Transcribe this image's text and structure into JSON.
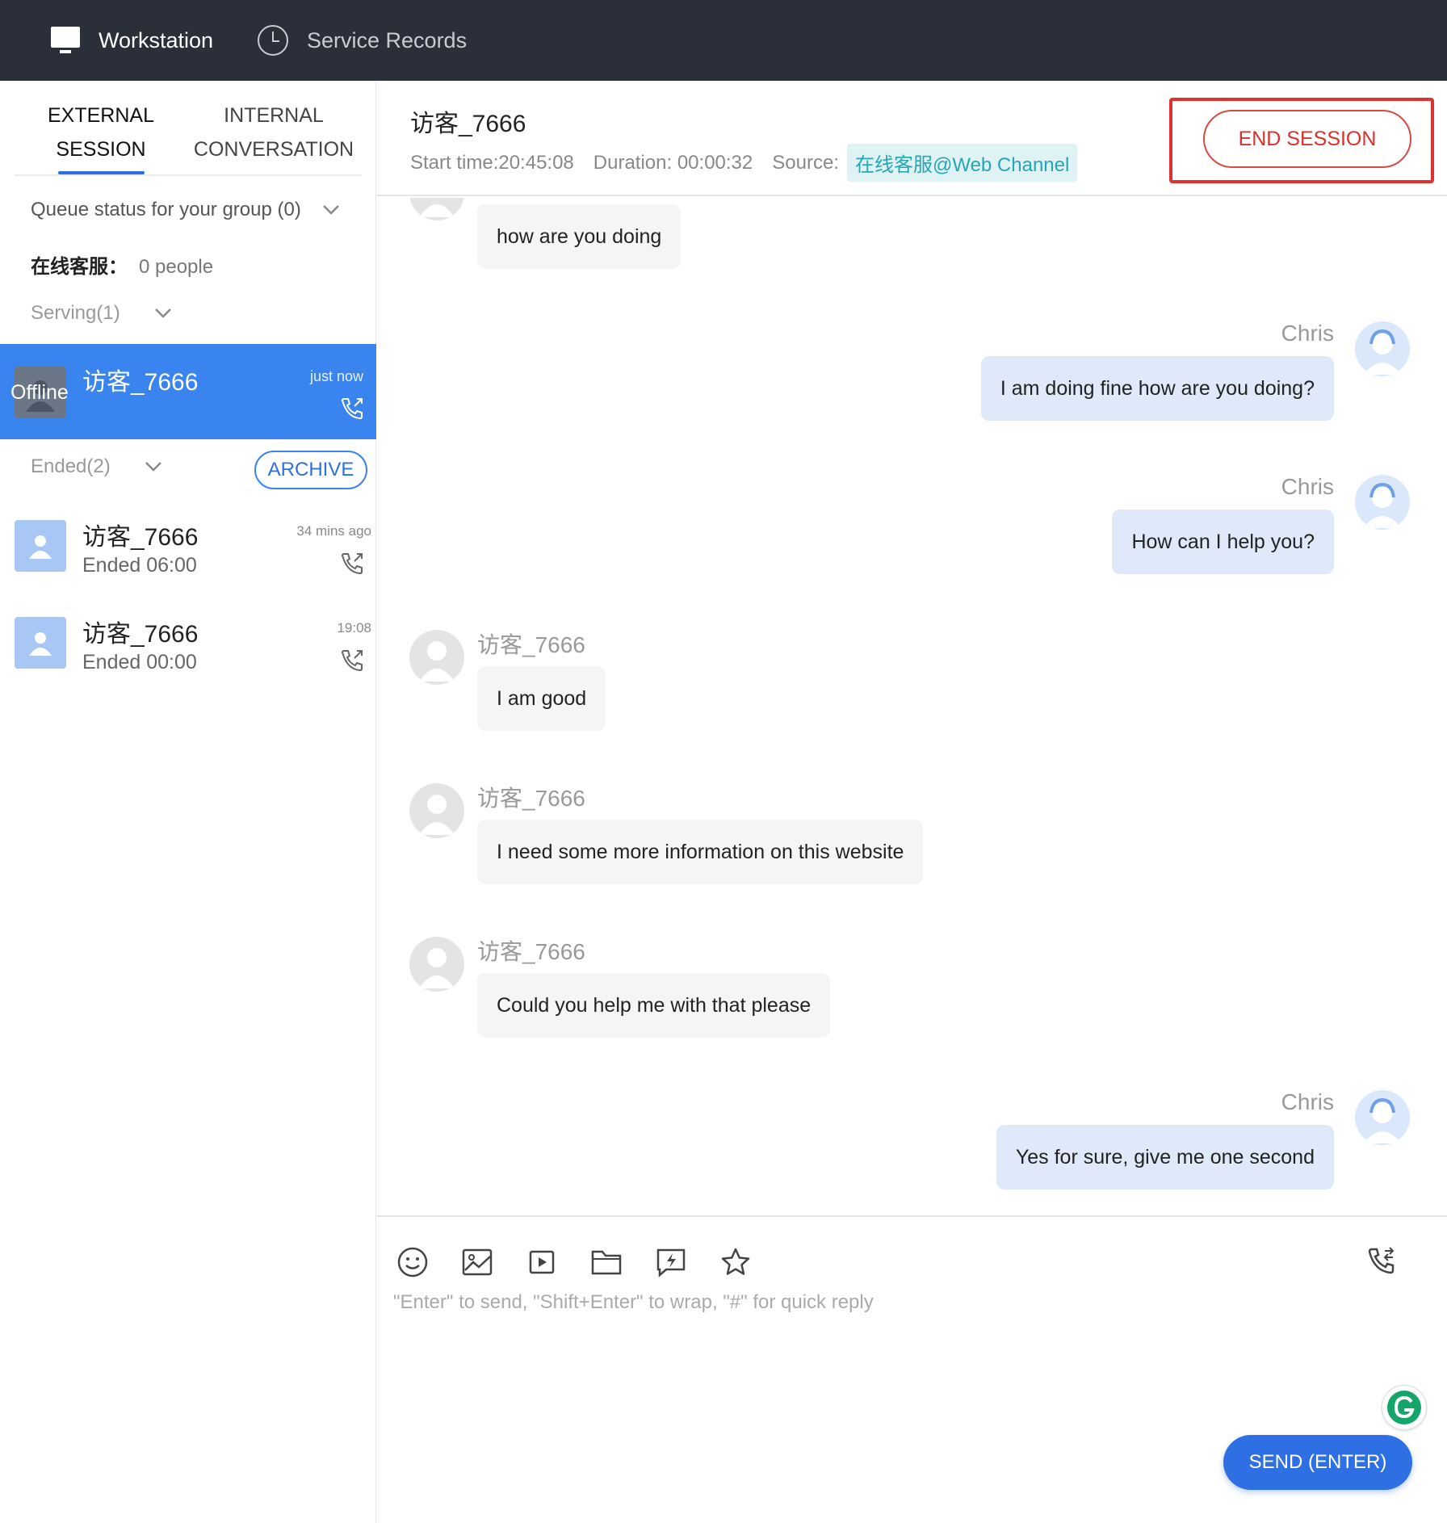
{
  "topbar": {
    "workstation_label": "Workstation",
    "service_records_label": "Service Records",
    "icons": {
      "workstation": "monitor-icon",
      "service_records": "clock-icon"
    }
  },
  "sidebar": {
    "tabs": [
      {
        "line1": "EXTERNAL",
        "line2": "SESSION",
        "active": true
      },
      {
        "line1": "INTERNAL",
        "line2": "CONVERSATION",
        "active": false
      }
    ],
    "queue_status": "Queue status for your group (0)",
    "online_group": "在线客服：",
    "online_count": "0 people",
    "serving_label": "Serving(1)",
    "active_session": {
      "name": "访客_7666",
      "time": "just now",
      "status": "Offline"
    },
    "ended_label": "Ended(2)",
    "archive_label": "ARCHIVE",
    "ended_sessions": [
      {
        "name": "访客_7666",
        "sub": "Ended 06:00",
        "time": "34 mins ago"
      },
      {
        "name": "访客_7666",
        "sub": "Ended 00:00",
        "time": "19:08"
      }
    ]
  },
  "header": {
    "visitor_name": "访客_7666",
    "start_time": "Start time:20:45:08",
    "duration": "Duration: 00:00:32",
    "source_label": "Source:",
    "source_value": "在线客服@Web Channel",
    "end_session_label": "END SESSION"
  },
  "chat": {
    "messages": [
      {
        "from": "visitor",
        "sender": "",
        "text": "how are you doing"
      },
      {
        "from": "agent",
        "sender": "Chris",
        "text": "I am doing fine how are you doing?"
      },
      {
        "from": "agent",
        "sender": "Chris",
        "text": "How can I help you?"
      },
      {
        "from": "visitor",
        "sender": "访客_7666",
        "text": "I am good"
      },
      {
        "from": "visitor",
        "sender": "访客_7666",
        "text": "I need some more information on this website"
      },
      {
        "from": "visitor",
        "sender": "访客_7666",
        "text": "Could you help me with that please"
      },
      {
        "from": "agent",
        "sender": "Chris",
        "text": "Yes for sure, give me one second"
      }
    ]
  },
  "composer": {
    "placeholder": "\"Enter\" to send, \"Shift+Enter\" to wrap, \"#\" for quick reply",
    "send_label": "SEND (ENTER)",
    "tools": [
      "emoji-icon",
      "image-icon",
      "video-icon",
      "folder-icon",
      "quick-reply-icon",
      "star-icon"
    ]
  },
  "colors": {
    "topbar_bg": "#2b2f3a",
    "accent": "#2f6fe4",
    "active_item_bg": "#3a84ef",
    "danger": "#d9322c",
    "source_tag_bg": "#dff3f4",
    "source_tag_fg": "#26a6b3"
  }
}
